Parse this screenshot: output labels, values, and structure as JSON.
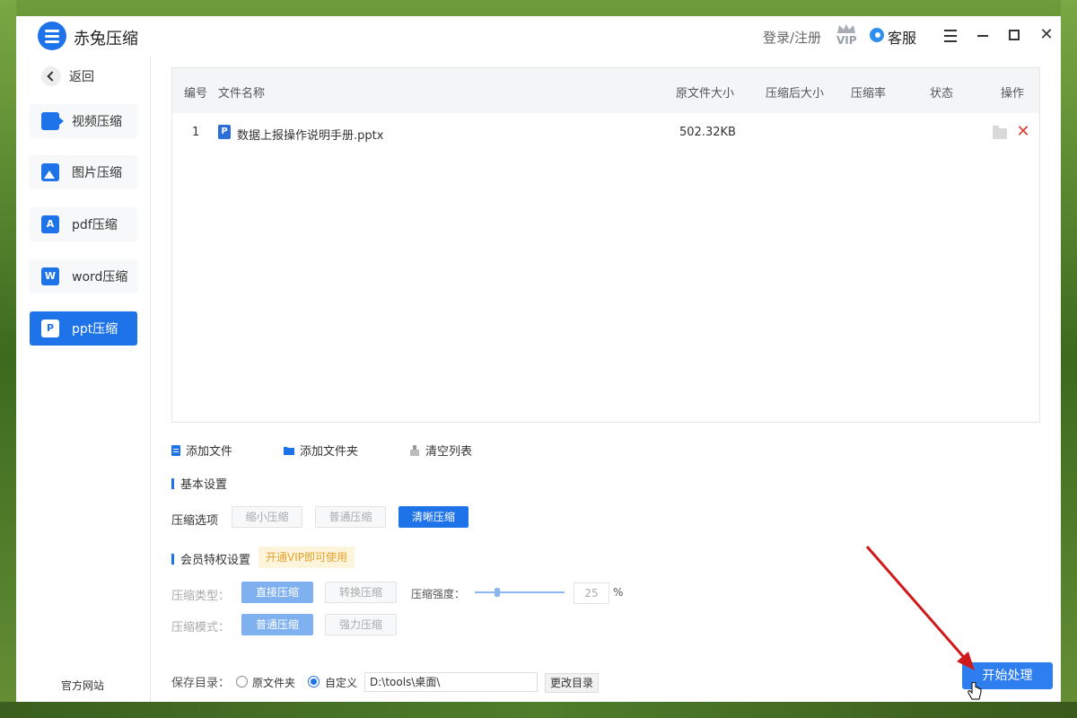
{
  "app": {
    "title": "赤兔压缩"
  },
  "header": {
    "login": "登录/注册",
    "vip_label": "VIP",
    "service": "客服"
  },
  "sidebar": {
    "back": "返回",
    "items": [
      {
        "label": "视频压缩",
        "icon": "video-icon",
        "active": false
      },
      {
        "label": "图片压缩",
        "icon": "image-icon",
        "active": false
      },
      {
        "label": "pdf压缩",
        "icon": "pdf-icon",
        "active": false
      },
      {
        "label": "word压缩",
        "icon": "word-icon",
        "active": false
      },
      {
        "label": "ppt压缩",
        "icon": "ppt-icon",
        "active": true
      }
    ],
    "website": "官方网站"
  },
  "table": {
    "columns": [
      "编号",
      "文件名称",
      "原文件大小",
      "压缩后大小",
      "压缩率",
      "状态",
      "操作"
    ],
    "rows": [
      {
        "index": "1",
        "name": "数据上报操作说明手册.pptx",
        "original_size": "502.32KB",
        "compressed_size": "",
        "ratio": "",
        "status": ""
      }
    ]
  },
  "actions": {
    "add_file": "添加文件",
    "add_folder": "添加文件夹",
    "clear_list": "清空列表"
  },
  "basic": {
    "title": "基本设置",
    "option_label": "压缩选项",
    "options": [
      "缩小压缩",
      "普通压缩",
      "清晰压缩"
    ],
    "selected": "清晰压缩"
  },
  "vip_settings": {
    "title": "会员特权设置",
    "tag": "开通VIP即可使用",
    "type_label": "压缩类型：",
    "types": [
      "直接压缩",
      "转换压缩"
    ],
    "strength_label": "压缩强度：",
    "strength_value": "25",
    "strength_unit": "%",
    "mode_label": "压缩模式：",
    "modes": [
      "普通压缩",
      "强力压缩"
    ]
  },
  "save": {
    "label": "保存目录：",
    "option_original": "原文件夹",
    "option_custom": "自定义",
    "selected": "自定义",
    "path": "D:\\tools\\桌面\\",
    "change_button": "更改目录"
  },
  "start_button": "开始处理",
  "colors": {
    "accent": "#1f73e8",
    "delete": "#e53935",
    "vip_tag_bg": "#fdf4dc",
    "vip_tag_text": "#e7a12a"
  }
}
